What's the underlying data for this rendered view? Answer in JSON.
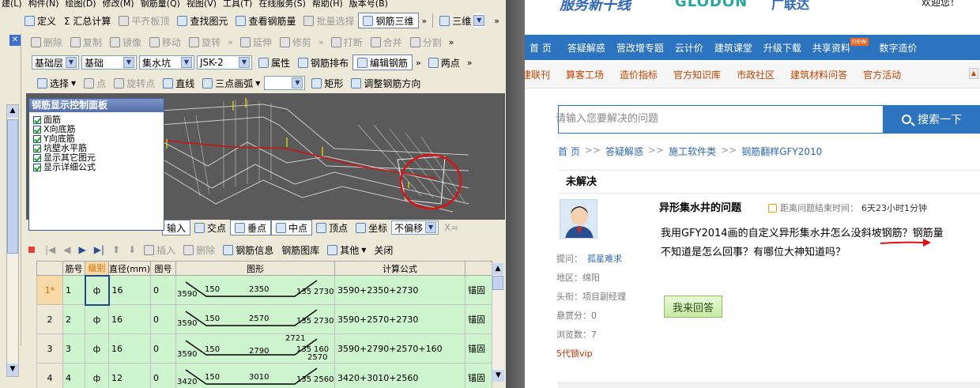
{
  "app": {
    "menubar_items": [
      "建(L)",
      "构件(N)",
      "绘图(D)",
      "修改(M)",
      "钢筋量(Q)",
      "视图(V)",
      "工具(T)",
      "在线服务(S)",
      "帮助(H)",
      "版本号(B)"
    ],
    "toolbar1": {
      "define": "定义",
      "sum": "Σ 汇总计算",
      "flat_top": "平齐板顶",
      "find": "查找图元",
      "view_rebar": "查看钢筋量",
      "batch_select": "批量选择",
      "rebar_3d": "钢筋三维",
      "view_3d": "三维"
    },
    "toolbar2": {
      "delete": "删除",
      "copy": "复制",
      "mirror": "镜像",
      "move": "移动",
      "rotate": "旋转",
      "extend": "延伸",
      "trim": "修剪",
      "break": "打断",
      "merge": "合并",
      "split": "分割"
    },
    "toolbar3": {
      "layer_value": "基础层",
      "category_value": "基础",
      "type_value": "集水坑",
      "item_value": "JSK-2",
      "props": "属性",
      "rebar_layout": "钢筋排布",
      "edit_rebar": "编辑钢筋",
      "two_points": "两点"
    },
    "toolbar4": {
      "select": "选择",
      "point": "点",
      "rotate_point": "旋转点",
      "line": "直线",
      "arc": "三点画弧",
      "rect": "矩形",
      "adjust_dir": "调整钢筋方向"
    },
    "panel": {
      "title": "钢筋显示控制面板",
      "items": [
        "面筋",
        "X向底筋",
        "Y向底筋",
        "坑壁水平筋",
        "显示其它图元",
        "显示详细公式"
      ]
    },
    "snapbar": {
      "input": "输入",
      "intersection": "交点",
      "perpendicular": "垂点",
      "midpoint": "中点",
      "vertex": "顶点",
      "coordinate": "坐标",
      "offset_value": "不偏移",
      "x_label": "X="
    },
    "grid_toolbar": {
      "insert": "插入",
      "delete": "删除",
      "rebar_info": "钢筋信息",
      "rebar_lib": "钢筋图库",
      "other": "其他",
      "close": "关闭"
    },
    "table": {
      "headers": [
        "",
        "筋号",
        "级别",
        "直径(mm)",
        "图号",
        "图形",
        "计算公式",
        ""
      ],
      "rows": [
        {
          "row": "1*",
          "no": "1",
          "level": "ф",
          "dia": "16",
          "fig": "0",
          "shape": {
            "left": "3590",
            "a": "150",
            "mid": "2350",
            "b": "135",
            "right": "2730"
          },
          "formula": "3590+2350+2730",
          "note": "锚固"
        },
        {
          "row": "2",
          "no": "2",
          "level": "ф",
          "dia": "16",
          "fig": "0",
          "shape": {
            "left": "3590",
            "a": "150",
            "mid": "2570",
            "b": "135",
            "right": "2730"
          },
          "formula": "3590+2570+2730",
          "note": "锚固"
        },
        {
          "row": "3",
          "no": "3",
          "level": "ф",
          "dia": "16",
          "fig": "0",
          "shape": {
            "left": "3590",
            "a": "150",
            "mid": "2790",
            "b": "135",
            "right": "160",
            "top": "2721",
            "bottom": "2570"
          },
          "formula": "3590+2790+2570+160",
          "note": "锚固"
        },
        {
          "row": "4",
          "no": "4",
          "level": "ф",
          "dia": "12",
          "fig": "0",
          "shape": {
            "left": "3420",
            "a": "150",
            "mid": "3010",
            "b": "135",
            "right": "2560"
          },
          "formula": "3420+3010+2560",
          "note": "锚固"
        }
      ]
    }
  },
  "browser": {
    "logo_text": "服务新干线",
    "logo_brand": "GLODON",
    "logo_suffix": "广联达",
    "welcome": "欢迎您！",
    "nav1": [
      "首 页",
      "答疑解惑",
      "营改增专题",
      "云计价",
      "建筑课堂",
      "升级下载",
      "共享资料",
      "数字造价"
    ],
    "new_badge": "new",
    "nav2": [
      "建联刊",
      "算客工场",
      "造价指标",
      "官方知识库",
      "市政社区",
      "建筑材料问答",
      "官方活动"
    ],
    "search_placeholder": "请输入您要解决的问题",
    "search_button": "搜索一下",
    "breadcrumb": [
      "首 页",
      "答疑解惑",
      "施工软件类",
      "钢筋翻样GFY2010"
    ],
    "status": "未解决",
    "question": {
      "title": "异形集水井的问题",
      "timer_label": "距离问题结束时间：",
      "timer_value": "6天23小时1分钟",
      "body_line1": "我用GFY2014画的自定义异形集水井怎么没斜坡钢筋？钢筋量",
      "body_line2": "不知道是怎么回事？有哪位大神知道吗？",
      "asker_label": "提问：",
      "asker": "孤星难求",
      "region_label": "地区：",
      "region": "绵阳",
      "title_label": "头衔：",
      "title_value": "项目副经理",
      "reward_label": "悬赏分：",
      "reward": "0",
      "views_label": "浏览数：",
      "views": "7",
      "vip": "5代锁vip",
      "answer_button": "我来回答"
    }
  }
}
